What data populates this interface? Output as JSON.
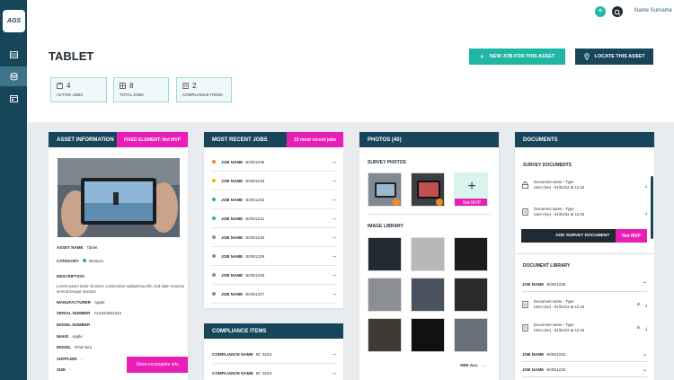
{
  "brand": {
    "logo_text": "AGS"
  },
  "topbar": {
    "user_name": "Name Surname",
    "add_icon": "+"
  },
  "page": {
    "title": "TABLET"
  },
  "actions": {
    "new_job": "NEW JOB FOR THIS ASSET",
    "locate": "LOCATE THIS ASSET"
  },
  "stats": [
    {
      "value": "4",
      "label": "ACTIVE JOBS"
    },
    {
      "value": "8",
      "label": "TOTAL JOBS"
    },
    {
      "value": "2",
      "label": "COMPLIANCE ITEMS"
    }
  ],
  "asset_info": {
    "title": "ASSET INFORMATION",
    "tag": "FIXED ELEMENT: Not MVP",
    "asset_name_label": "ASSET NAME",
    "asset_name": "Tablet",
    "category_label": "CATEGORY",
    "category": "Devices",
    "description_label": "DESCRIPTION",
    "description": "Lorem ipsum dolor sit amet, consectetur sadipscing elitr, sed diam nonumy eirmod tempor invidunt",
    "manufacturer_label": "MANUFACTURER",
    "manufacturer": "Apple",
    "serial_label": "SERIAL NUMBER",
    "serial": "A12344364343",
    "model_number_label": "MODEL NUMBER",
    "model_number": "-",
    "make_label": "MAKE",
    "make": "Apple",
    "model_label": "MODEL",
    "model": "iPad mini",
    "supplier_label": "SUPPLIER",
    "supplier": "-",
    "size_label": "SIZE",
    "size": "-",
    "show_incomplete": "Show incomplete info"
  },
  "recent_jobs": {
    "title": "MOST RECENT JOBS",
    "tag": "10 most recent jobs",
    "label": "JOB NAME",
    "items": [
      {
        "id": "IE/001235",
        "color": "#f08a24"
      },
      {
        "id": "IE/001233",
        "color": "#f5b400"
      },
      {
        "id": "IE/001232",
        "color": "#1fb7a4"
      },
      {
        "id": "IE/001231",
        "color": "#1fb7a4"
      },
      {
        "id": "IE/001230",
        "color": "#8a8f94"
      },
      {
        "id": "IE/001229",
        "color": "#8a8f94"
      },
      {
        "id": "IE/001228",
        "color": "#8a8f94"
      },
      {
        "id": "IE/001227",
        "color": "#8a8f94"
      }
    ]
  },
  "compliance": {
    "title": "COMPLIANCE ITEMS",
    "label": "COMPLIANCE NAME",
    "items": [
      {
        "id": "ID: 3243"
      },
      {
        "id": "ID: 3243"
      }
    ]
  },
  "photos": {
    "title": "PHOTOS (40)",
    "survey_label": "SURVEY PHOTOS",
    "library_label": "IMAGE LIBRARY",
    "not_mvp": "Not MVP",
    "see_all": "SEE ALL"
  },
  "documents": {
    "title": "DOCUMENTS",
    "survey_label": "SURVEY DOCUMENTS",
    "items": [
      {
        "name": "Document name - Type",
        "meta": "User (me) - 01/01/22 at 12:34"
      },
      {
        "name": "Document name - Type",
        "meta": "User (me) - 01/01/22 at 12:34"
      }
    ],
    "add_survey": "ADD SURVEY DOCUMENT",
    "not_mvp": "Not MVP",
    "library_label": "DOCUMENT LIBRARY",
    "job_label": "JOB NAME",
    "lib_job_open": "IE/001235",
    "lib_items": [
      {
        "name": "Document name - Type",
        "meta": "User (me) - 01/01/22 at 12:34"
      },
      {
        "name": "Document name - Type",
        "meta": "User (me) - 01/01/22 at 12:34"
      }
    ],
    "lib_jobs": [
      "IE/001234",
      "IE/001233"
    ]
  },
  "colors": {
    "primary": "#17465a",
    "accent": "#1fb7a4",
    "pink": "#e81eb6"
  }
}
